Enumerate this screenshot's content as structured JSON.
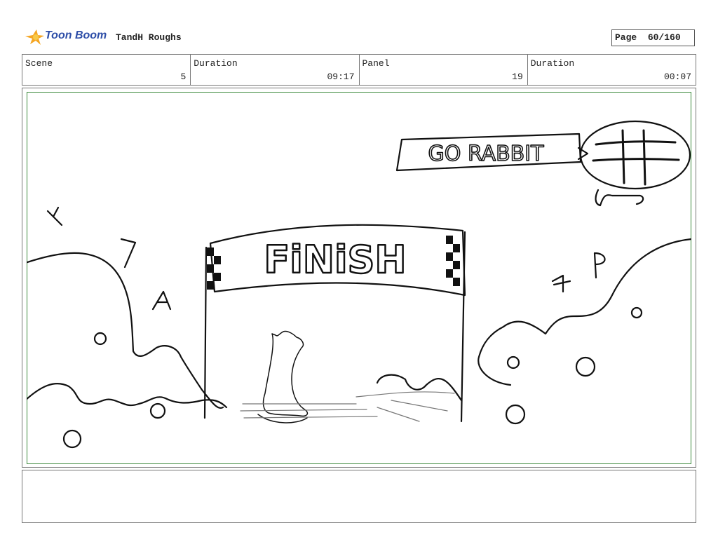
{
  "header": {
    "logo_text": "Toon Boom",
    "project_title": "TandH Roughs",
    "page_label": "Page",
    "page_value": "60/160"
  },
  "info": {
    "scene_label": "Scene",
    "scene_value": "5",
    "duration_label": "Duration",
    "duration_value": "09:17",
    "panel_label": "Panel",
    "panel_value": "19",
    "panel_duration_label": "Duration",
    "panel_duration_value": "00:07"
  },
  "sketch": {
    "banner_text": "FiNiSH",
    "blimp_sign_text": "GO RABBIT"
  },
  "notes": {
    "text": ""
  },
  "colors": {
    "logo_blue": "#2f4fa8",
    "logo_orange": "#f5a623",
    "panel_border_green": "#3c8a3c"
  }
}
